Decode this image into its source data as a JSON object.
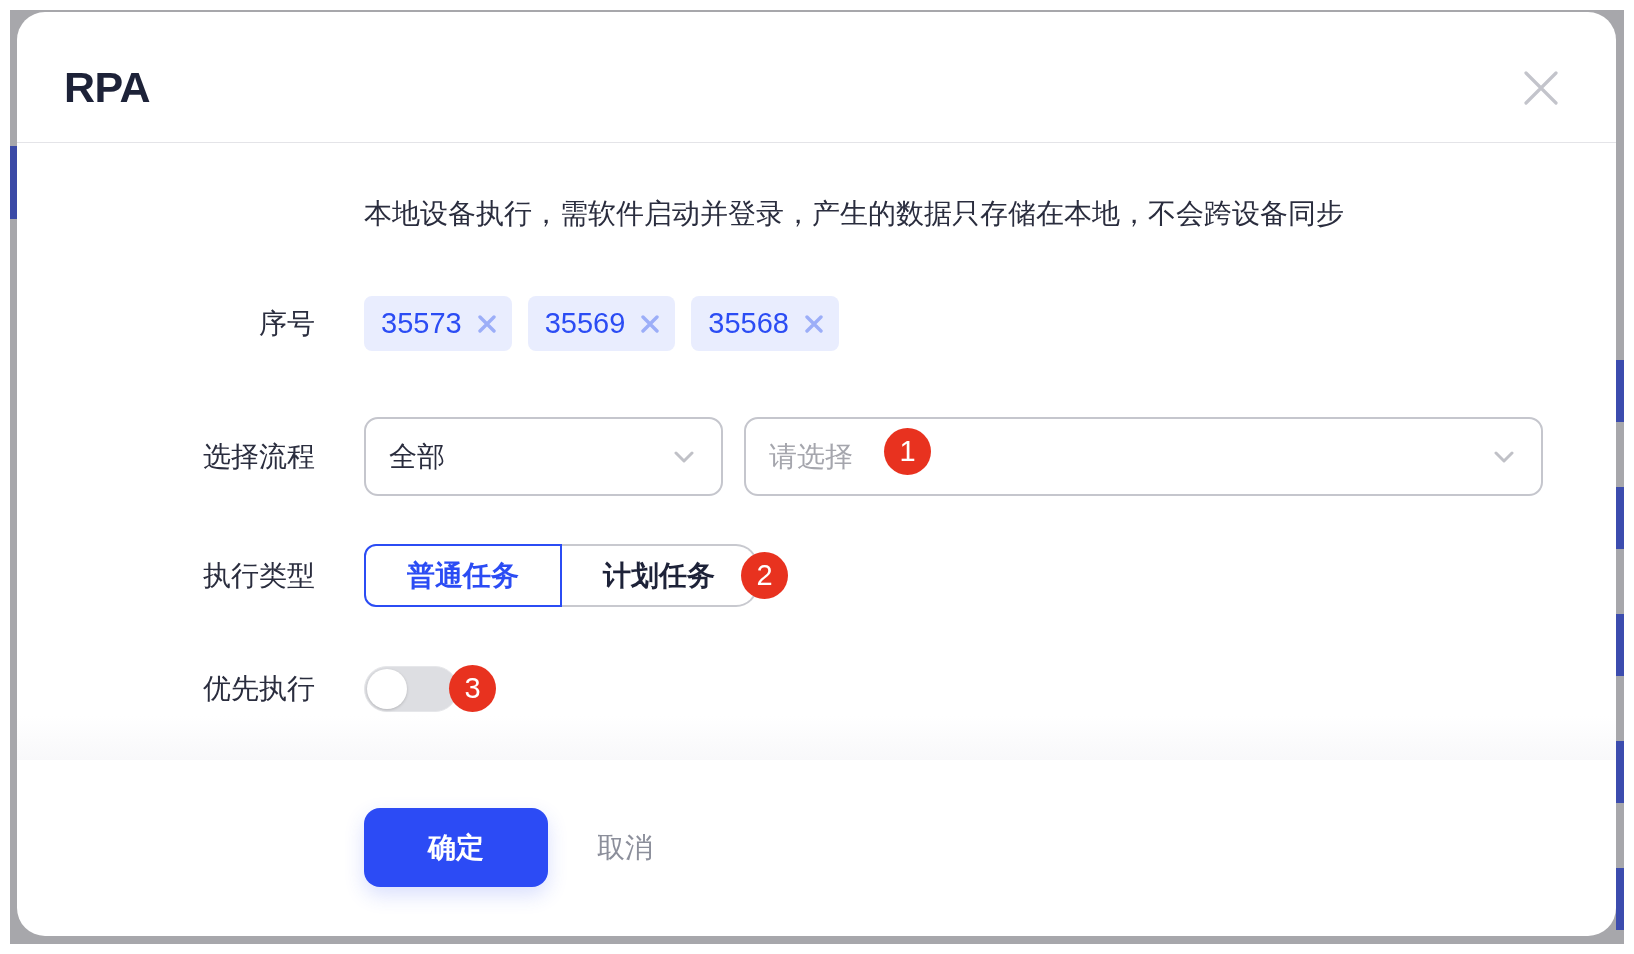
{
  "dialog": {
    "title": "RPA",
    "description": "本地设备执行，需软件启动并登录，产生的数据只存储在本地，不会跨设备同步",
    "serial": {
      "label": "序号",
      "tags": [
        {
          "label": "35573"
        },
        {
          "label": "35569"
        },
        {
          "label": "35568"
        }
      ]
    },
    "process": {
      "label": "选择流程",
      "selects": [
        {
          "value": "全部"
        },
        {
          "placeholder": "请选择",
          "marker": "1"
        }
      ]
    },
    "exec_type": {
      "label": "执行类型",
      "options": [
        {
          "label": "普通任务",
          "selected": true
        },
        {
          "label": "计划任务",
          "selected": false
        }
      ],
      "marker": "2"
    },
    "priority": {
      "label": "优先执行",
      "on": false,
      "marker": "3"
    },
    "buttons": [
      {
        "label": "确定",
        "kind": "primary"
      },
      {
        "label": "取消",
        "kind": "text"
      }
    ]
  }
}
